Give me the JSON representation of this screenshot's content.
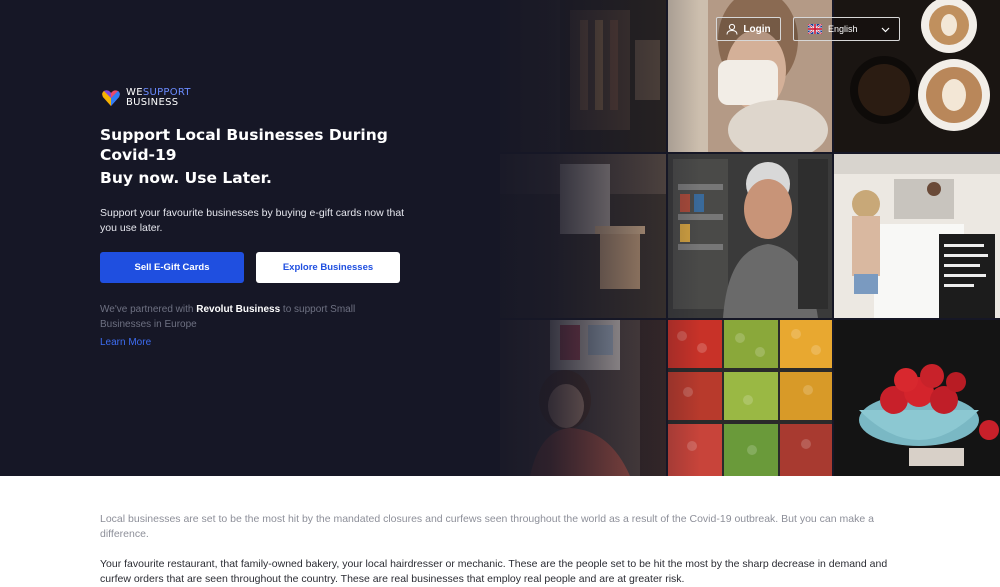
{
  "header": {
    "login_label": "Login",
    "language_label": "English",
    "icons": {
      "login": "user-icon",
      "flag": "uk-flag-icon",
      "dropdown": "chevron-down-icon"
    }
  },
  "logo": {
    "line1_a": "WE",
    "line1_b": "SUPPORT",
    "line2": "BUSINESS",
    "icon": "heart-logo-icon"
  },
  "hero": {
    "headline": "Support Local Businesses During Covid-19",
    "subheadline": "Buy now. Use Later.",
    "description": "Support your favourite businesses by buying e-gift cards now that you use later.",
    "primary_button": "Sell E-Gift Cards",
    "secondary_button": "Explore Businesses",
    "partner_prefix": "We've partnered with ",
    "partner_brand": "Revolut Business",
    "partner_suffix": " to support Small Businesses in Europe",
    "learn_more": "Learn More"
  },
  "photos": [
    "shop-interior",
    "person-eating",
    "latte-art",
    "bakery-counter",
    "shop-owner",
    "cafe-counter",
    "woman-smiling",
    "vegetable-market",
    "strawberries"
  ],
  "colors": {
    "hero_bg": "#161726",
    "accent": "#1f4fe0",
    "link": "#3d6cf0"
  },
  "body": {
    "paragraph1": "Local businesses are set to be the most hit by the mandated closures and curfews seen throughout the world as a result of the Covid-19 outbreak. But you can make a difference.",
    "paragraph2": "Your favourite restaurant, that family-owned bakery, your local hairdresser or mechanic. These are the people set to be hit the most by the sharp decrease in demand and curfew orders that are seen throughout the country. These are real businesses that employ real people and are at greater risk."
  }
}
